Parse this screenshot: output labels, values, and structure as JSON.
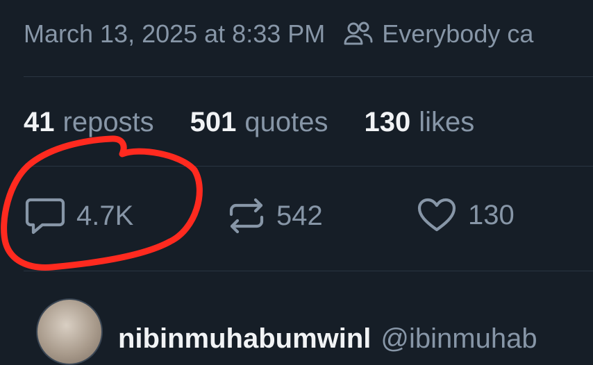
{
  "post_meta": {
    "timestamp": "March 13, 2025 at 8:33 PM",
    "audience_icon": "people-icon",
    "audience_text": "Everybody ca"
  },
  "stats": [
    {
      "count": "41",
      "label": "reposts"
    },
    {
      "count": "501",
      "label": "quotes"
    },
    {
      "count": "130",
      "label": "likes"
    }
  ],
  "actions": {
    "reply": {
      "icon": "comment-icon",
      "count": "4.7K"
    },
    "repost": {
      "icon": "repost-icon",
      "count": "542"
    },
    "like": {
      "icon": "heart-icon",
      "count": "130"
    }
  },
  "annotation": {
    "shape": "hand-drawn circle around reply count",
    "color": "#ff2a1f"
  },
  "reply_preview": {
    "name": "nibinmuhabumwinl",
    "handle": "@ibinmuhab"
  },
  "colors": {
    "background": "#161e27",
    "text_primary": "#f1f3f5",
    "text_secondary": "#8796a7",
    "divider": "#2a3542"
  }
}
